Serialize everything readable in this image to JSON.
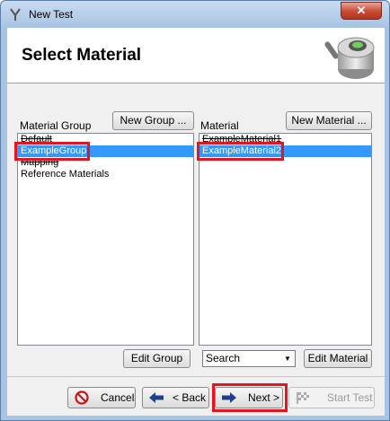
{
  "window": {
    "title": "New Test",
    "close_glyph": "✕"
  },
  "header": {
    "title": "Select Material",
    "art_icon": "sensor-icon"
  },
  "material_group": {
    "label": "Material Group",
    "new_button": "New Group ...",
    "edit_button": "Edit Group",
    "items": [
      {
        "text": "Default",
        "selected": false,
        "struck": true
      },
      {
        "text": "ExampleGroup",
        "selected": true,
        "struck": false
      },
      {
        "text": "Mapping",
        "selected": false,
        "struck": true
      },
      {
        "text": "Reference Materials",
        "selected": false,
        "struck": false
      }
    ]
  },
  "material": {
    "label": "Material",
    "new_button": "New Material ...",
    "edit_button": "Edit Material",
    "search_value": "Search",
    "items": [
      {
        "text": "ExampleMaterial1",
        "selected": false,
        "struck": true
      },
      {
        "text": "ExampleMaterial2",
        "selected": true,
        "struck": false
      }
    ]
  },
  "footer": {
    "cancel": "Cancel",
    "back": "< Back",
    "next": "Next >",
    "start": "Start Test"
  },
  "colors": {
    "selection": "#3399ff",
    "highlight": "#e8141d"
  }
}
